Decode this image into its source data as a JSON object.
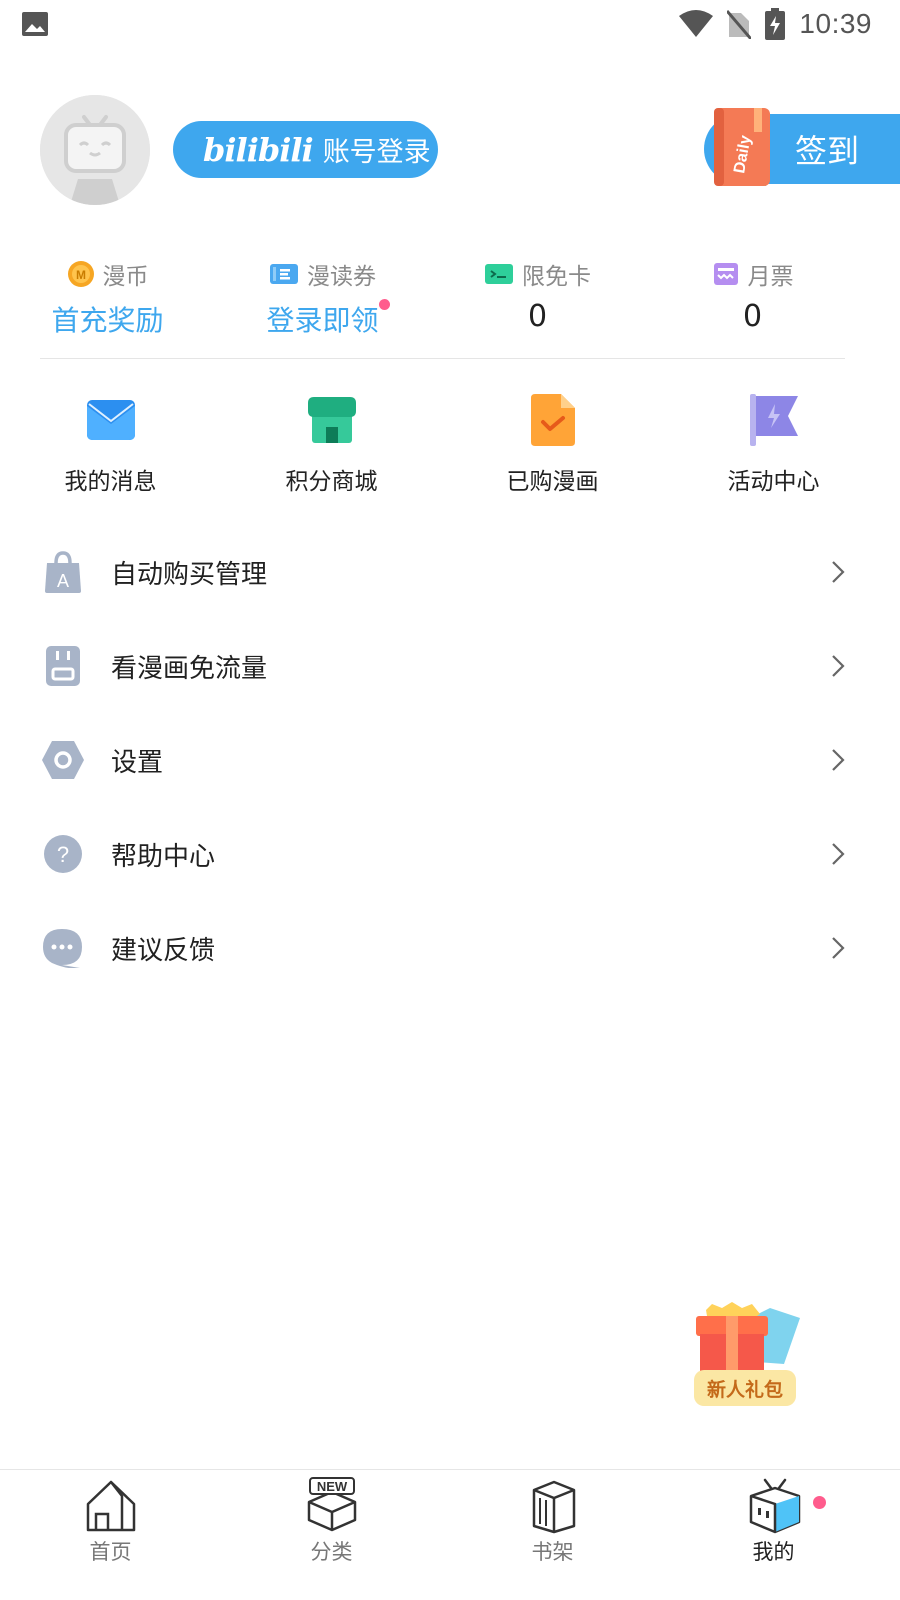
{
  "status_bar": {
    "time": "10:39"
  },
  "profile": {
    "login_logo": "bilibili",
    "login_label": "账号登录",
    "signin_label": "签到",
    "daily_label": "Daily"
  },
  "wallet": [
    {
      "label": "漫币",
      "value": "首充奖励",
      "style": "blue",
      "icon": "coin-icon"
    },
    {
      "label": "漫读券",
      "value": "登录即领",
      "style": "blue",
      "icon": "ticket-icon",
      "dot": true
    },
    {
      "label": "限免卡",
      "value": "0",
      "style": "dark",
      "icon": "free-card-icon"
    },
    {
      "label": "月票",
      "value": "0",
      "style": "dark",
      "icon": "monthly-ticket-icon"
    }
  ],
  "shortcuts": [
    {
      "label": "我的消息",
      "icon": "envelope-icon"
    },
    {
      "label": "积分商城",
      "icon": "store-icon"
    },
    {
      "label": "已购漫画",
      "icon": "purchased-comic-icon"
    },
    {
      "label": "活动中心",
      "icon": "flag-icon"
    }
  ],
  "menu": [
    {
      "label": "自动购买管理",
      "icon": "shopping-bag-icon"
    },
    {
      "label": "看漫画免流量",
      "icon": "sim-card-icon"
    },
    {
      "label": "设置",
      "icon": "settings-hexagon-icon"
    },
    {
      "label": "帮助中心",
      "icon": "help-icon"
    },
    {
      "label": "建议反馈",
      "icon": "feedback-bubble-icon"
    }
  ],
  "gift": {
    "label": "新人礼包"
  },
  "bottom_nav": [
    {
      "label": "首页",
      "icon": "home-icon",
      "active": false
    },
    {
      "label": "分类",
      "icon": "category-new-icon",
      "active": false
    },
    {
      "label": "书架",
      "icon": "bookshelf-icon",
      "active": false
    },
    {
      "label": "我的",
      "icon": "profile-tv-icon",
      "active": true
    }
  ],
  "colors": {
    "accent": "#3ea7ee",
    "dot": "#ff5c8d",
    "icon_gray": "#a8b4c8"
  }
}
